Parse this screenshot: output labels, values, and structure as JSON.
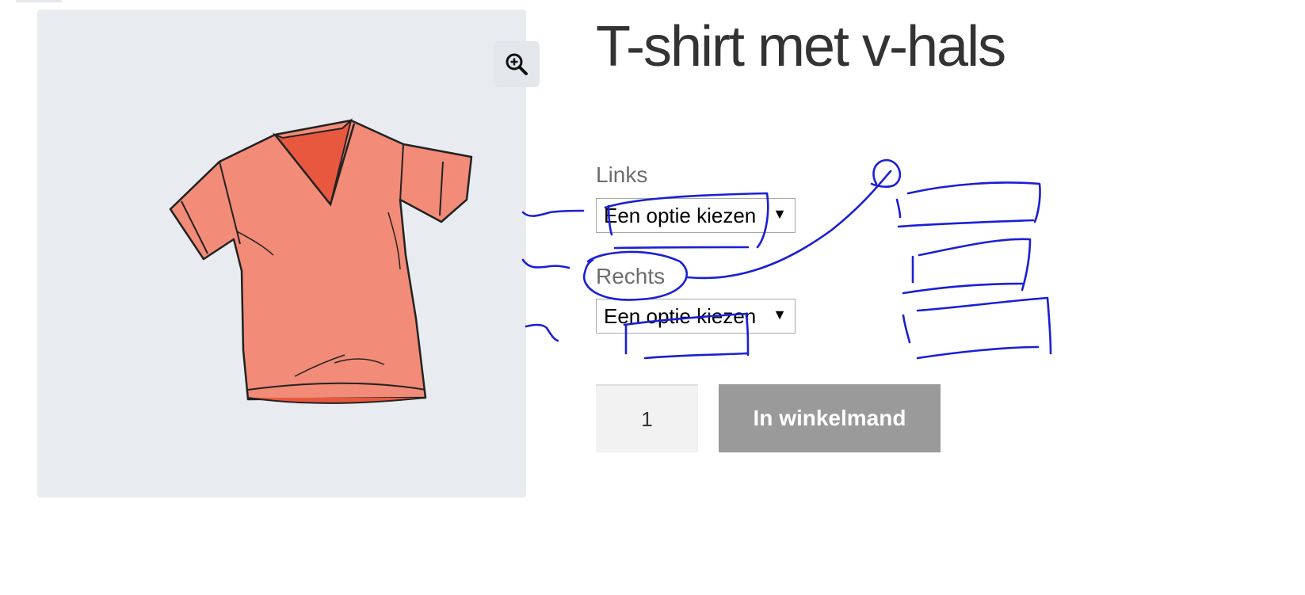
{
  "product": {
    "title": "T-shirt met v-hals"
  },
  "variations": [
    {
      "label": "Links",
      "selected": "Een optie kiezen"
    },
    {
      "label": "Rechts",
      "selected": "Een optie kiezen"
    }
  ],
  "quantity": "1",
  "add_to_cart_label": "In winkelmand",
  "icons": {
    "zoom": "zoom-in-icon",
    "select_arrow": "caret-down-icon"
  },
  "colors": {
    "gallery_bg": "#e8ecf1",
    "shirt": "#f28b77",
    "button_disabled": "#9a9a9a",
    "annotation_ink": "#1a1fd6"
  }
}
